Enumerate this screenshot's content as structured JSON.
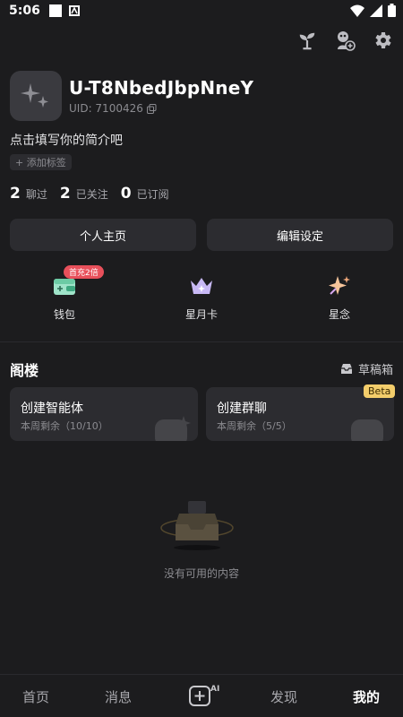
{
  "status_bar": {
    "time": "5:06"
  },
  "profile": {
    "username": "U-T8NbedJbpNneY",
    "uid_label": "UID: 7100426",
    "bio": "点击填写你的简介吧",
    "add_tag": "+ 添加标签"
  },
  "stats": [
    {
      "num": "2",
      "label": "聊过"
    },
    {
      "num": "2",
      "label": "已关注"
    },
    {
      "num": "0",
      "label": "已订阅"
    }
  ],
  "buttons": {
    "profile": "个人主页",
    "edit": "编辑设定"
  },
  "features": [
    {
      "label": "钱包",
      "badge": "首充2倍",
      "icon": "wallet-icon"
    },
    {
      "label": "星月卡",
      "icon": "crown-icon"
    },
    {
      "label": "星念",
      "icon": "sparkle-icon"
    }
  ],
  "section": {
    "title": "阁楼",
    "drafts": "草稿箱"
  },
  "cards": [
    {
      "title": "创建智能体",
      "sub": "本周剩余（10/10）"
    },
    {
      "title": "创建群聊",
      "sub": "本周剩余（5/5）",
      "badge": "Beta"
    }
  ],
  "empty": {
    "text": "没有可用的内容"
  },
  "nav": {
    "home": "首页",
    "messages": "消息",
    "create_icon": "ai-create-icon",
    "discover": "发现",
    "mine": "我的"
  },
  "colors": {
    "background": "#1c1c1e",
    "card": "#2c2c30",
    "badge_red": "#e8505b",
    "beta_yellow": "#f3cd6b"
  }
}
